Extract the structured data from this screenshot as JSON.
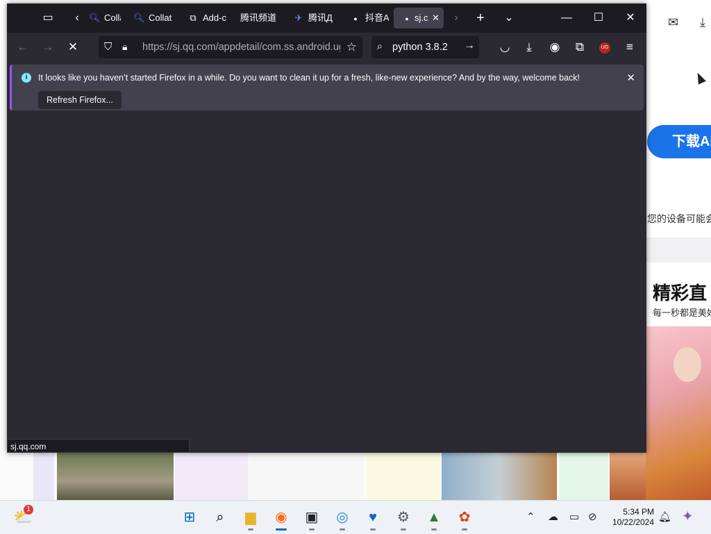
{
  "browser": {
    "tabs": [
      {
        "label": "Colla",
        "icon": "search-icon"
      },
      {
        "label": "Collat",
        "icon": "search-icon"
      },
      {
        "label": "Add-c",
        "icon": "puzzle-icon"
      },
      {
        "label": "腾讯频道",
        "icon": "blank-icon"
      },
      {
        "label": "腾讯Д",
        "icon": "app-icon"
      },
      {
        "label": "抖音A",
        "icon": "dot-icon"
      },
      {
        "label": "sj.c",
        "icon": "dot-icon",
        "active": true
      }
    ],
    "url": "https://sj.qq.com/appdetail/com.ss.android.ugc",
    "search_text": "python 3.8.2",
    "notification": {
      "message": "It looks like you haven’t started Firefox in a while. Do you want to clean it up for a fresh, like-new experience? And by the way, welcome back!",
      "button_label": "Refresh Firefox..."
    },
    "status_url": "sj.qq.com",
    "icons": {
      "back": "arrow-left-icon",
      "forward": "arrow-right-icon",
      "stop": "close-icon",
      "shield": "shield-icon",
      "lock": "lock-icon",
      "bookmark": "star-icon",
      "pocket": "pocket-icon",
      "downloads": "download-icon",
      "account": "account-icon",
      "extensions": "puzzle-icon",
      "ublock": "ublock-icon",
      "menu": "hamburger-icon"
    },
    "ublock_badge": "UO"
  },
  "background_page": {
    "download_button": "下载AP",
    "device_text": "您的设备可能会",
    "heading": "精彩直",
    "subheading": "每一秒都是美好"
  },
  "taskbar": {
    "weather_badge": "1",
    "clock_time": "5:34 PM",
    "clock_date": "10/22/2024",
    "apps": [
      "start-icon",
      "search-icon",
      "file-explorer-icon",
      "firefox-icon",
      "terminal-icon",
      "chrome-icon",
      "health-icon",
      "settings-icon",
      "app-icon",
      "photos-icon"
    ]
  },
  "colors": {
    "accent": "#0067c0",
    "firefox_dark": "#2b2a33",
    "notif_border": "#9059ff"
  }
}
